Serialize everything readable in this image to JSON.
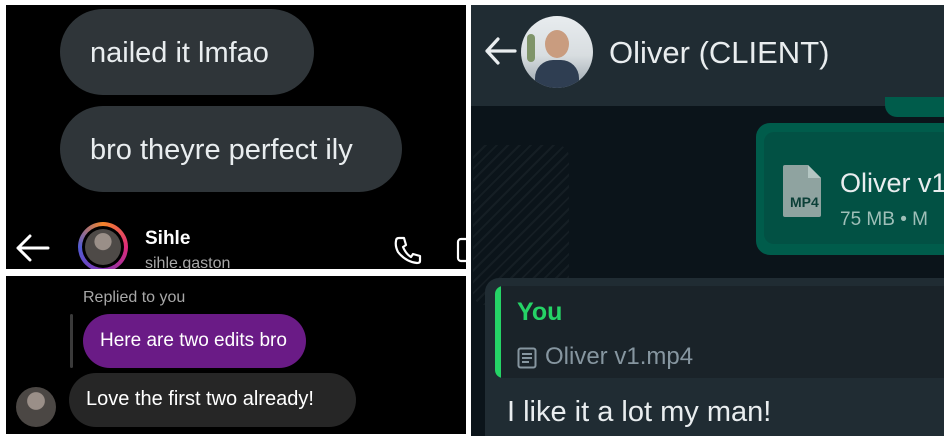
{
  "instagram_thread": {
    "messages": [
      "nailed it lmfao",
      "bro theyre perfect ily"
    ],
    "header": {
      "name": "Sihle",
      "username": "sihle.gaston"
    }
  },
  "instagram_reply": {
    "replied_label": "Replied to you",
    "quoted_message": "Here are two edits bro",
    "message": "Love the first two already!"
  },
  "whatsapp": {
    "contact_name": "Oliver (CLIENT)",
    "file": {
      "badge": "MP4",
      "name": "Oliver v1",
      "meta": "75 MB • M"
    },
    "reply": {
      "author": "You",
      "quoted_file": "Oliver v1.mp4",
      "message": "I like it a lot my man!"
    }
  },
  "colors": {
    "whatsapp_accent": "#25d366",
    "ig_purple": "#6a1b86"
  }
}
